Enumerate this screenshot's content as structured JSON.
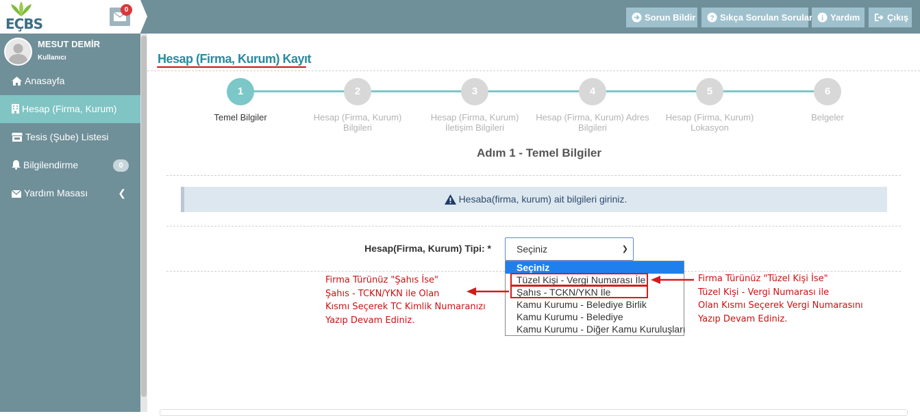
{
  "topbar": {
    "logo_text": "EÇBS",
    "mail_badge": "0",
    "buttons": [
      {
        "label": "Sorun Bildir",
        "icon": "arrow-right-circle-icon"
      },
      {
        "label": "Sıkça Sorulan Sorular",
        "icon": "question-circle-icon"
      },
      {
        "label": "Yardım",
        "icon": "info-circle-icon"
      },
      {
        "label": "Çıkış",
        "icon": "sign-out-icon"
      }
    ]
  },
  "user": {
    "name": "MESUT DEMİR",
    "role": "Kullanıcı"
  },
  "sidebar": {
    "items": [
      {
        "label": "Anasayfa",
        "icon": "home-icon",
        "active": false
      },
      {
        "label": "Hesap (Firma, Kurum)",
        "icon": "building-icon",
        "active": true
      },
      {
        "label": "Tesis (Şube) Listesi",
        "icon": "store-icon",
        "active": false
      },
      {
        "label": "Bilgilendirme",
        "icon": "bell-icon",
        "active": false,
        "badge": "0"
      },
      {
        "label": "Yardım Masası",
        "icon": "envelope-icon",
        "active": false
      }
    ]
  },
  "page": {
    "title": "Hesap (Firma, Kurum) Kayıt"
  },
  "steps": [
    {
      "number": "1",
      "line1": "Temel Bilgiler",
      "line2": "",
      "active": true
    },
    {
      "number": "2",
      "line1": "Hesap (Firma, Kurum)",
      "line2": "Bilgileri",
      "active": false
    },
    {
      "number": "3",
      "line1": "Hesap (Firma, Kurum)",
      "line2": "İletişim Bilgileri",
      "active": false
    },
    {
      "number": "4",
      "line1": "Hesap (Firma, Kurum) Adres",
      "line2": "Bilgileri",
      "active": false
    },
    {
      "number": "5",
      "line1": "Hesap (Firma, Kurum)",
      "line2": "Lokasyon",
      "active": false
    },
    {
      "number": "6",
      "line1": "Belgeler",
      "line2": "",
      "active": false
    }
  ],
  "step_title": "Adım 1 - Temel Bilgiler",
  "alert": {
    "text": "Hesaba(firma, kurum) ait bilgileri giriniz.",
    "icon": "warning-icon"
  },
  "form": {
    "label": "Hesap(Firma, Kurum) Tipi: *",
    "selected": "Seçiniz",
    "options": [
      "Seçiniz",
      "Tüzel Kişi - Vergi Numarası İle",
      "Şahıs - TCKN/YKN İle",
      "Kamu Kurumu - Belediye Birlik",
      "Kamu Kurumu - Belediye",
      "Kamu Kurumu - Diğer Kamu Kuruluşları"
    ]
  },
  "annotations": {
    "left": [
      "Firma Türünüz \"Şahıs İse\"",
      "Şahıs - TCKN/YKN ile Olan",
      "Kısmı Seçerek TC Kimlik Numaranızı",
      "Yazıp Devam Ediniz."
    ],
    "right": [
      "Firma Türünüz \"Tüzel Kişi İse\"",
      "Tüzel Kişi - Vergi Numarası ile",
      "Olan Kısmı Seçerek Vergi Numarasını",
      "Yazıp Devam Ediniz."
    ]
  },
  "colors": {
    "accent": "#7cc7c7",
    "sidebar": "#6f8f99",
    "title": "#2a8aa0",
    "annotation": "#cc1111",
    "selected_option": "#1f80ed"
  }
}
